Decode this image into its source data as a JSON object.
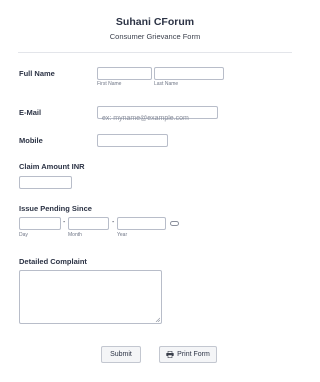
{
  "form": {
    "title": "Suhani CForum",
    "subtitle": "Consumer Grievance Form"
  },
  "full_name": {
    "label": "Full Name",
    "first_sublabel": "First Name",
    "last_sublabel": "Last Name",
    "first_value": "",
    "last_value": ""
  },
  "email": {
    "label": "E-Mail",
    "placeholder": "ex: myname@example.com",
    "value": ""
  },
  "mobile": {
    "label": "Mobile",
    "value": ""
  },
  "claim": {
    "label": "Claim Amount INR",
    "value": ""
  },
  "issue_date": {
    "label": "Issue Pending Since",
    "separator": "-",
    "day_sublabel": "Day",
    "month_sublabel": "Month",
    "year_sublabel": "Year",
    "calendar_icon": "calendar-icon"
  },
  "complaint": {
    "label": "Detailed Complaint",
    "value": ""
  },
  "buttons": {
    "submit_label": "Submit",
    "print_label": "Print Form",
    "print_icon": "printer-icon"
  }
}
